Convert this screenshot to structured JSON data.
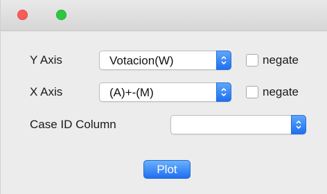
{
  "window": {
    "buttons": [
      "close",
      "zoom"
    ]
  },
  "form": {
    "y_axis": {
      "label": "Y Axis",
      "value": "Votacion(W)",
      "negate_label": "negate",
      "negate_checked": false
    },
    "x_axis": {
      "label": "X Axis",
      "value": "(A)+-(M)",
      "negate_label": "negate",
      "negate_checked": false
    },
    "case_id": {
      "label": "Case ID Column",
      "value": ""
    },
    "plot_button": "Plot"
  },
  "colors": {
    "accent": "#1e6ff0",
    "close": "#fc5b57",
    "zoom": "#2dc83f",
    "window_bg": "#ececec"
  },
  "icons": {
    "popup_arrows": "chevron-up-down-icon"
  }
}
